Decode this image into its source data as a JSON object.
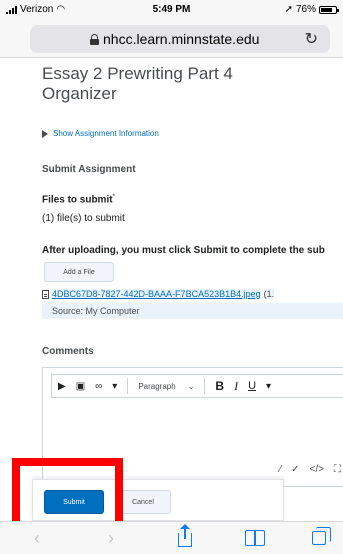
{
  "status_bar": {
    "carrier": "Verizon",
    "wifi_icon": "wifi-icon",
    "time": "5:49 PM",
    "location_icon": "location-arrow-icon",
    "battery": "76%"
  },
  "address_bar": {
    "url": "nhcc.learn.minnstate.edu",
    "lock_icon": "lock-icon",
    "reload_icon": "reload-icon"
  },
  "page": {
    "title": "Essay 2 Prewriting Part 4 Organizer",
    "show_info_link": "Show Assignment Information",
    "submit_heading": "Submit Assignment",
    "files_label": "Files to submit",
    "required_marker": "*",
    "files_count": "(1) file(s) to submit",
    "notice": "After uploading, you must click Submit to complete the sub",
    "add_file_button": "Add a File",
    "file": {
      "name": "4DBC67D8-7827-442D-BAAA-F7BCA523B1B4.jpeg",
      "size_partial": "(1.",
      "source": "Source: My Computer"
    },
    "comments_label": "Comments",
    "editor": {
      "format_select": "Paragraph",
      "bold": "B",
      "italic": "I",
      "underline": "U"
    }
  },
  "actions": {
    "submit": "Submit",
    "cancel": "Cancel"
  },
  "colors": {
    "accent": "#006fbf",
    "highlight": "#ff0000",
    "ios_blue": "#0a7aff"
  }
}
